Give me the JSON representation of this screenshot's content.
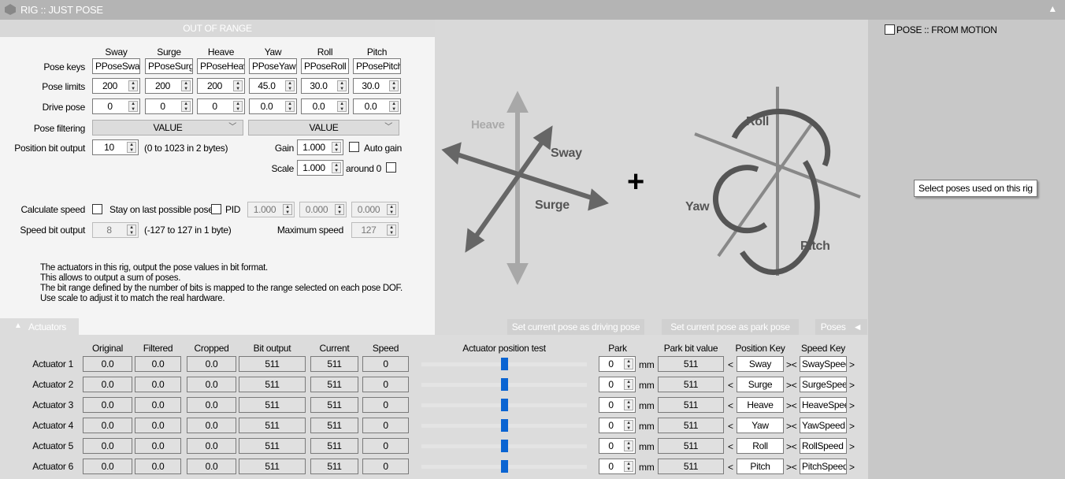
{
  "window": {
    "title": "RIG :: JUST POSE",
    "collapse_icon": "▲"
  },
  "pose": {
    "banner": "OUT OF RANGE",
    "dofs": [
      "Sway",
      "Surge",
      "Heave",
      "Yaw",
      "Roll",
      "Pitch"
    ],
    "row_labels": {
      "keys": "Pose keys",
      "limits": "Pose limits",
      "drive": "Drive pose",
      "filter": "Pose filtering",
      "bit": "Position bit output"
    },
    "keys": [
      "PPoseSway",
      "PPoseSurge",
      "PPoseHeave",
      "PPoseYaw",
      "PPoseRoll",
      "PPosePitch"
    ],
    "limits": [
      "200",
      "200",
      "200",
      "45.0",
      "30.0",
      "30.0"
    ],
    "drive": [
      "0",
      "0",
      "0",
      "0.0",
      "0.0",
      "0.0"
    ],
    "filter": [
      "VALUE",
      "VALUE"
    ],
    "bit_output": "10",
    "bit_range": "(0 to 1023 in 2 bytes)",
    "gain_label": "Gain",
    "gain": "1.000",
    "auto_gain": "Auto gain",
    "scale_label": "Scale",
    "scale": "1.000",
    "around": "around 0",
    "calc_speed": "Calculate speed",
    "stay_last": "Stay on last possible pose",
    "pid": "PID",
    "pid_values": [
      "1.000",
      "0.000",
      "0.000"
    ],
    "speed_bit_label": "Speed bit output",
    "speed_bit": "8",
    "speed_range": "(-127 to 127 in 1 byte)",
    "max_speed_label": "Maximum speed",
    "max_speed": "127",
    "notes": [
      "The actuators in this rig, output the pose values in bit format.",
      "This allows to output a sum of poses.",
      "The bit range defined by the number of bits is mapped to the range selected on each pose DOF.",
      "Use scale to adjust it to match the real hardware."
    ]
  },
  "diagram": {
    "heave": "Heave",
    "sway": "Sway",
    "surge": "Surge",
    "plus": "+",
    "roll": "Roll",
    "yaw": "Yaw",
    "pitch": "Pitch"
  },
  "actuators": {
    "tab": "Actuators",
    "tab_icon": "▲",
    "set_driving": "Set current pose as driving pose",
    "set_park": "Set current pose as park pose",
    "poses": "Poses",
    "poses_icon": "◄",
    "headers": [
      "Original",
      "Filtered",
      "Cropped",
      "Bit output",
      "Current",
      "Speed",
      "Actuator position test",
      "Park",
      "Park bit value",
      "Position Key",
      "Speed Key"
    ],
    "unit": "mm",
    "rows": [
      {
        "name": "Actuator 1",
        "original": "0.0",
        "filtered": "0.0",
        "cropped": "0.0",
        "bit": "511",
        "current": "511",
        "speed": "0",
        "test": 0.5,
        "park": "0",
        "park_bit": "511",
        "pos_key": "Sway",
        "speed_key": "SwaySpeed"
      },
      {
        "name": "Actuator 2",
        "original": "0.0",
        "filtered": "0.0",
        "cropped": "0.0",
        "bit": "511",
        "current": "511",
        "speed": "0",
        "test": 0.5,
        "park": "0",
        "park_bit": "511",
        "pos_key": "Surge",
        "speed_key": "SurgeSpeed"
      },
      {
        "name": "Actuator 3",
        "original": "0.0",
        "filtered": "0.0",
        "cropped": "0.0",
        "bit": "511",
        "current": "511",
        "speed": "0",
        "test": 0.5,
        "park": "0",
        "park_bit": "511",
        "pos_key": "Heave",
        "speed_key": "HeaveSpeed"
      },
      {
        "name": "Actuator 4",
        "original": "0.0",
        "filtered": "0.0",
        "cropped": "0.0",
        "bit": "511",
        "current": "511",
        "speed": "0",
        "test": 0.5,
        "park": "0",
        "park_bit": "511",
        "pos_key": "Yaw",
        "speed_key": "YawSpeed"
      },
      {
        "name": "Actuator 5",
        "original": "0.0",
        "filtered": "0.0",
        "cropped": "0.0",
        "bit": "511",
        "current": "511",
        "speed": "0",
        "test": 0.5,
        "park": "0",
        "park_bit": "511",
        "pos_key": "Roll",
        "speed_key": "RollSpeed"
      },
      {
        "name": "Actuator 6",
        "original": "0.0",
        "filtered": "0.0",
        "cropped": "0.0",
        "bit": "511",
        "current": "511",
        "speed": "0",
        "test": 0.5,
        "park": "0",
        "park_bit": "511",
        "pos_key": "Pitch",
        "speed_key": "PitchSpeed"
      }
    ]
  },
  "poses_panel": {
    "from_motion": "POSE :: FROM MOTION",
    "tooltip": "Select poses used on this rig"
  }
}
